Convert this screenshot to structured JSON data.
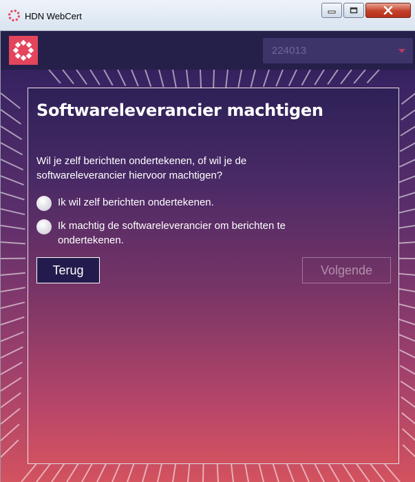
{
  "window": {
    "title": "HDN WebCert",
    "controls": {
      "minimize": "minimize",
      "maximize": "maximize",
      "close": "close"
    }
  },
  "header": {
    "user_select": {
      "value": "224013"
    }
  },
  "dialog": {
    "title": "Softwareleverancier machtigen",
    "question": "Wil je zelf berichten ondertekenen, of wil je de softwareleverancier hiervoor machtigen?",
    "options": [
      {
        "label": "Ik wil zelf berichten ondertekenen.",
        "selected": false
      },
      {
        "label": "Ik machtig de softwareleverancier om berichten te ondertekenen.",
        "selected": false
      }
    ],
    "back_label": "Terug",
    "next_label": "Volgende",
    "next_enabled": false
  },
  "colors": {
    "accent": "#e3455d",
    "topbar": "#25204a",
    "gradient_top": "#261d52",
    "gradient_bottom": "#d3525f"
  }
}
